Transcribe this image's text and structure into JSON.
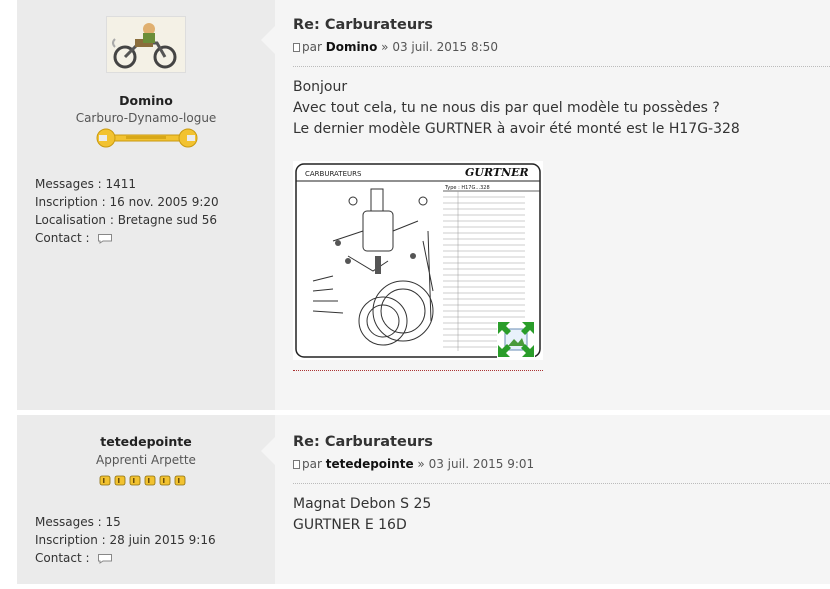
{
  "posts": [
    {
      "user": {
        "name": "Domino",
        "rank": "Carburo-Dynamo-logue",
        "messages": "Messages : 1411",
        "inscription": "Inscription : 16 nov. 2005 9:20",
        "localisation": "Localisation : Bretagne sud 56",
        "contact": "Contact :"
      },
      "title": "Re: Carburateurs",
      "meta": {
        "prefix": "par",
        "author": "Domino",
        "date": "» 03 juil. 2015 8:50"
      },
      "body": [
        "Bonjour",
        "Avec tout cela, tu ne nous dis par quel modèle tu possèdes ?",
        "Le dernier modèle GURTNER à avoir été monté est le H17G-328"
      ],
      "diagram": {
        "brand": "GURTNER",
        "header_left": "CARBURATEURS",
        "type_label": "Type : H17G...328"
      }
    },
    {
      "user": {
        "name": "tetedepointe",
        "rank": "Apprenti Arpette",
        "messages": "Messages : 15",
        "inscription": "Inscription : 28 juin 2015 9:16",
        "contact": "Contact :"
      },
      "title": "Re: Carburateurs",
      "meta": {
        "prefix": "par",
        "author": "tetedepointe",
        "date": "» 03 juil. 2015 9:01"
      },
      "body": [
        "Magnat Debon S 25",
        "GURTNER E 16D"
      ]
    }
  ],
  "colors": {
    "profile_bg": "#ebebeb",
    "content_bg": "#f5f5f5",
    "rank_gold": "#f2c230"
  }
}
